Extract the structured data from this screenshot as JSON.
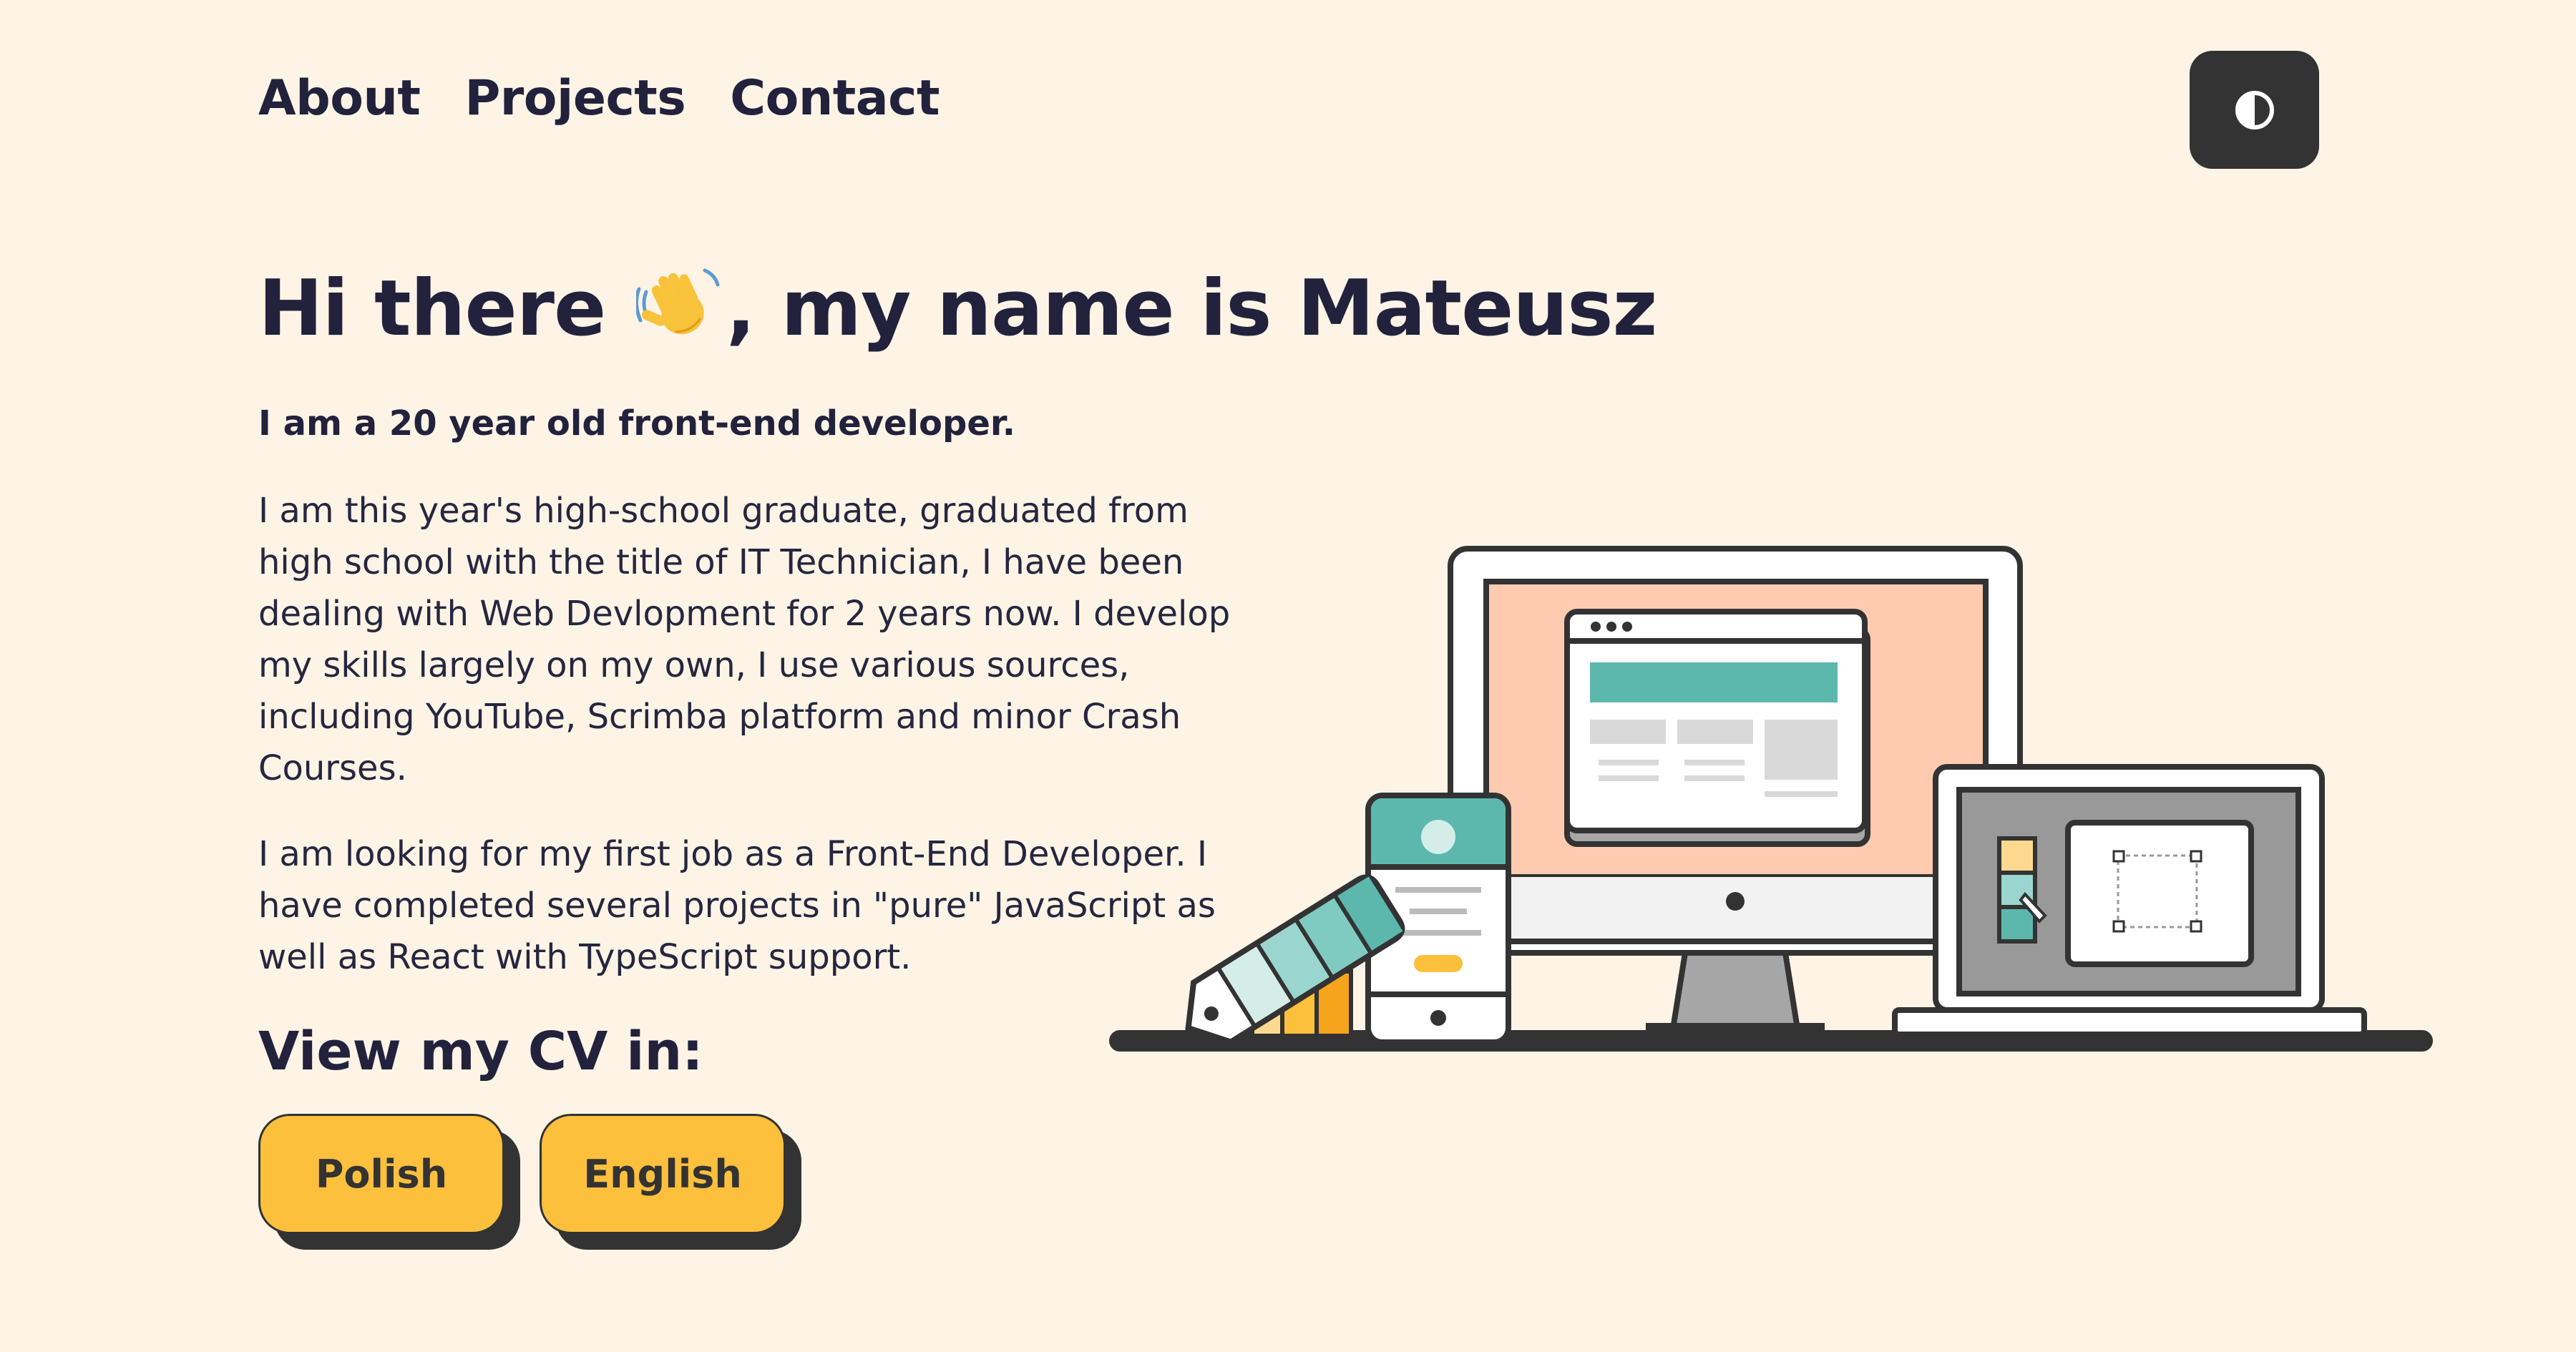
{
  "nav": {
    "items": [
      {
        "label": "About"
      },
      {
        "label": "Projects"
      },
      {
        "label": "Contact"
      }
    ]
  },
  "theme_toggle": {
    "icon": "contrast-icon"
  },
  "hero": {
    "title_before": "Hi there",
    "wave_icon": "waving-hand-icon",
    "title_after": ", my name is Mateusz",
    "lead": "I am a 20 year old front-end developer.",
    "paragraphs": [
      "I am this year's high-school graduate, graduated from high school with the title of IT Technician, I have been dealing with Web Devlopment for 2 years now. I develop my skills largely on my own, I use various sources, including YouTube, Scrimba platform and minor Crash Courses.",
      "I am looking for my first job as a Front-End Developer. I have completed several projects in \"pure\" JavaScript as well as React with TypeScript support."
    ]
  },
  "cv": {
    "title": "View my CV in:",
    "buttons": [
      {
        "label": "Polish"
      },
      {
        "label": "English"
      }
    ]
  },
  "colors": {
    "background": "#fdf4e6",
    "text": "#22223d",
    "button_yellow": "#fcc03d",
    "dark": "#333333",
    "teal": "#5cb8ad",
    "peach": "#ffcbb0"
  }
}
